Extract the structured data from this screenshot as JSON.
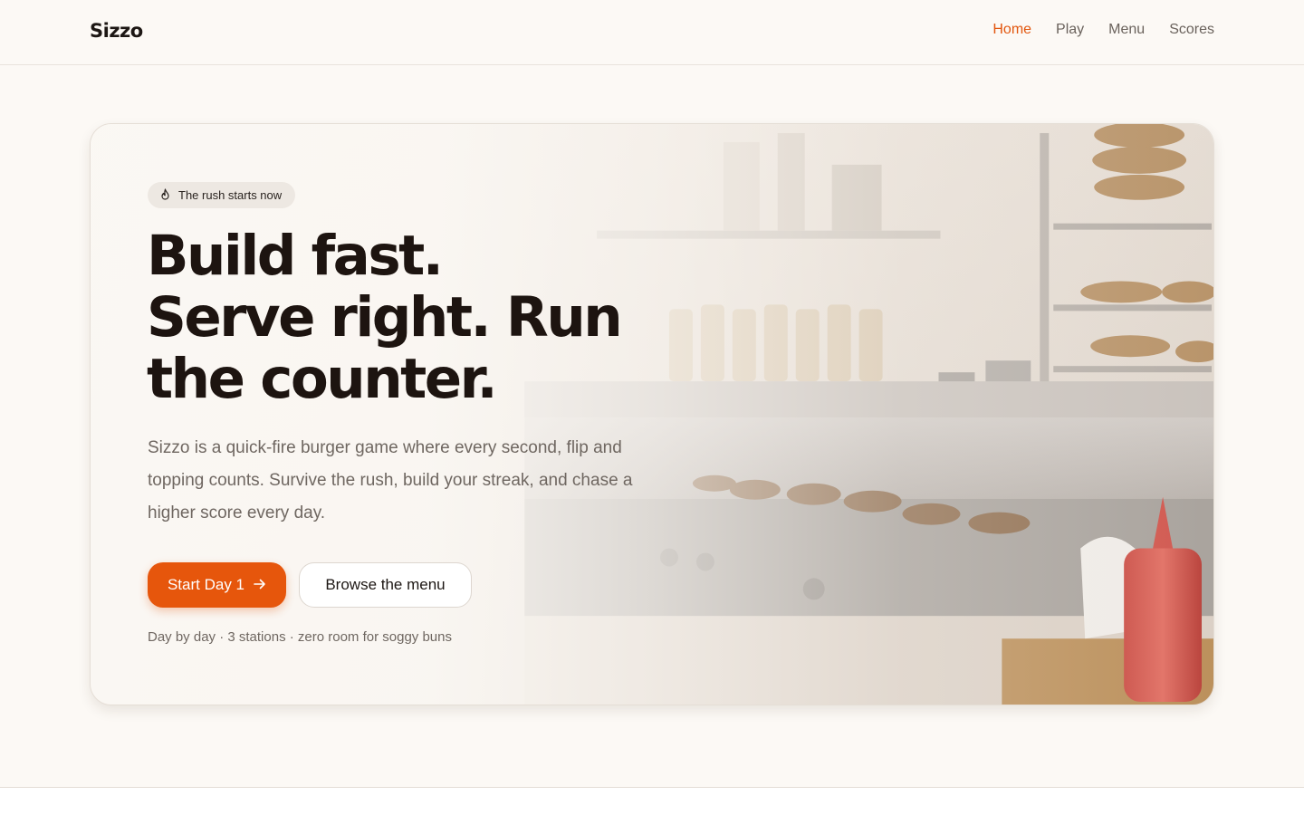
{
  "brand": {
    "name": "Sizzo"
  },
  "nav": {
    "items": [
      {
        "label": "Home",
        "active": true
      },
      {
        "label": "Play",
        "active": false
      },
      {
        "label": "Menu",
        "active": false
      },
      {
        "label": "Scores",
        "active": false
      }
    ]
  },
  "hero": {
    "badge": {
      "icon": "flame-icon",
      "text": "The rush starts now"
    },
    "headline": [
      "Build fast.",
      "Serve right. Run",
      "the counter."
    ],
    "description": "Sizzo is a quick-fire burger game where every second, flip and topping counts. Survive the rush, build your streak, and chase a higher score every day.",
    "primary_cta": {
      "label": "Start Day 1",
      "icon": "arrow-right-icon"
    },
    "secondary_cta": {
      "label": "Browse the menu"
    },
    "footnote": "Day by day · 3 stations · zero room for soggy buns"
  },
  "colors": {
    "accent": "#e6560c",
    "background": "#fcf9f5",
    "text": "#1d1410",
    "muted": "#6f6761"
  }
}
